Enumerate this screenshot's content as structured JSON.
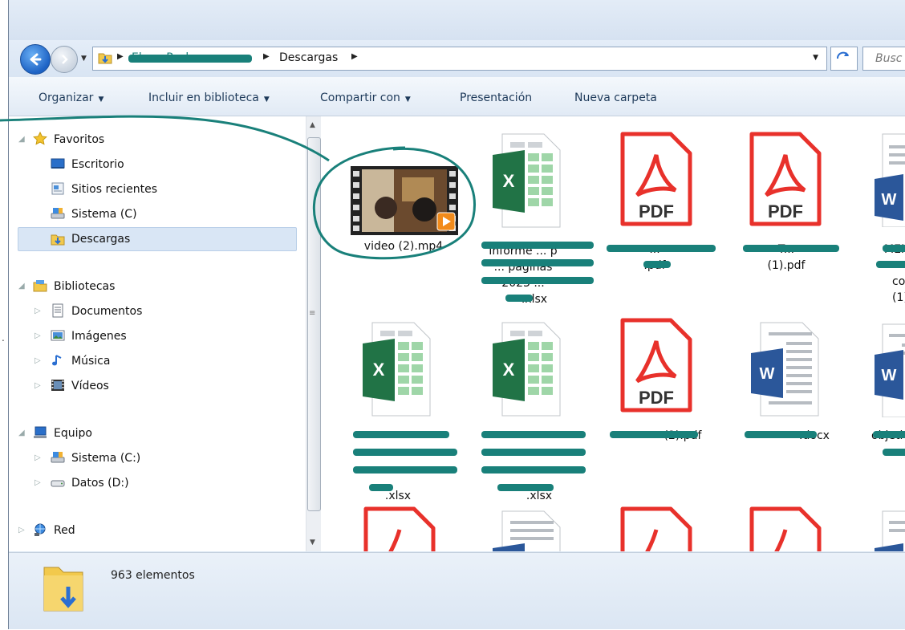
{
  "address": {
    "path_hidden": "Elena Pacheco",
    "crumb_current": "Descargas",
    "search_placeholder": "Busc"
  },
  "toolbar": {
    "organize": "Organizar",
    "include": "Incluir en biblioteca",
    "share": "Compartir con",
    "presentation": "Presentación",
    "new_folder": "Nueva carpeta"
  },
  "nav": {
    "favorites": "Favoritos",
    "desktop": "Escritorio",
    "recent": "Sitios recientes",
    "system": "Sistema (C)",
    "downloads": "Descargas",
    "libraries": "Bibliotecas",
    "documents": "Documentos",
    "images": "Imágenes",
    "music": "Música",
    "videos": "Vídeos",
    "computer": "Equipo",
    "system_c": "Sistema (C:)",
    "data_d": "Datos (D:)",
    "network": "Red"
  },
  "files": {
    "f1": "video (2).mp4",
    "f2a": "Informe ... p",
    "f2b": "... páginas",
    "f2c": "2023 ...",
    "f2d": ".xlsx",
    "f3a": "...",
    "f3b": ".pdf",
    "f4a": "T...",
    "f4b": "(1).pdf",
    "f5a": "MEN",
    "f5b": "corr",
    "f5c": "(1)",
    "f6d": ".xlsx",
    "f7d": ".xlsx",
    "f8": "(2).pdf",
    "f9": ".docx",
    "f10": "objetiv"
  },
  "status": {
    "count": "963 elementos"
  },
  "colors": {
    "annotation": "#19807a",
    "pdf_red": "#e8312b",
    "excel_green": "#217346",
    "word_blue": "#2b579a"
  }
}
